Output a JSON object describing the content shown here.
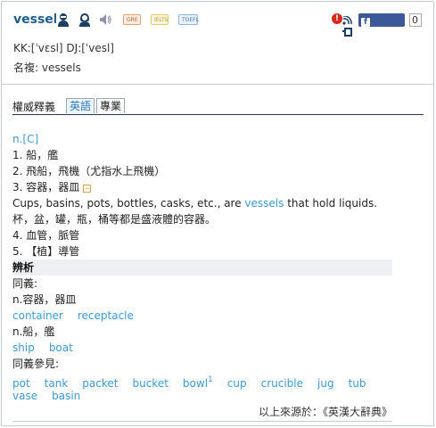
{
  "header": {
    "word": "vessel",
    "icons": [
      "man-voice-icon",
      "woman-voice-icon",
      "speaker-icon"
    ],
    "exams": [
      "GRE",
      "IELTS",
      "TOEFL"
    ],
    "alert": "!",
    "share_label": "Share",
    "share_count": "0",
    "phonetic": "KK:[ˈvɛsl] DJ:[ˈvesl]",
    "plural": "名複: vessels"
  },
  "tabs": {
    "label": "權威釋義",
    "items": [
      "英語",
      "專業"
    ]
  },
  "definitions": {
    "pos": "n.[C]",
    "senses": [
      "1. 船，艦",
      "2. 飛船，飛機（尤指水上飛機）",
      "3. 容器，器皿",
      "4. 血管，脈管",
      "5. 【植】導管"
    ],
    "example_pre": "Cups, basins, pots, bottles, casks, etc., are ",
    "example_link": "vessels",
    "example_post": " that hold liquids.",
    "example_translation": "杯，盆，罐，瓶，桶等都是盛液體的容器。"
  },
  "analysis": {
    "title": "辨析",
    "synonyms_label": "同義:",
    "group1_label": "n.容器，器皿",
    "group1_words": [
      "container",
      "receptacle"
    ],
    "group2_label": "n.船，艦",
    "group2_words": [
      "ship",
      "boat"
    ],
    "see_also_label": "同義參見:",
    "see_also_row1": [
      "pot",
      "tank",
      "packet",
      "bucket",
      "bowl",
      "cup",
      "crucible",
      "jug",
      "tub"
    ],
    "bowl_sup": "1",
    "see_also_row2": [
      "vase",
      "basin"
    ]
  },
  "source": "以上來源於：《英漢大辭典》"
}
